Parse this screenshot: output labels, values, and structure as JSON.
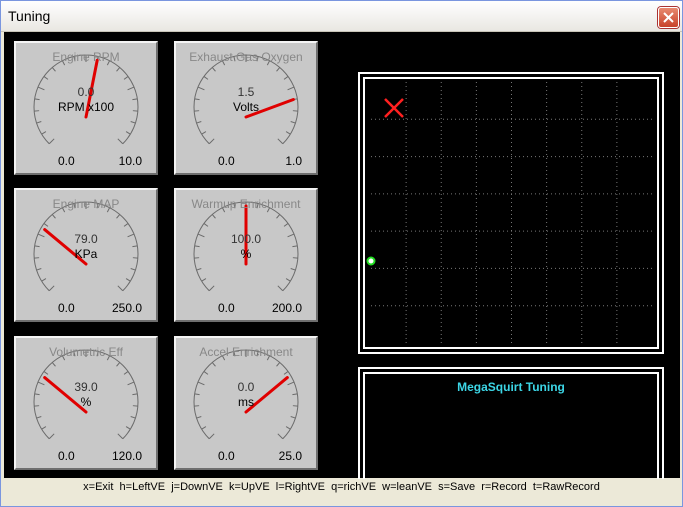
{
  "window": {
    "title": "Tuning"
  },
  "gauges": [
    {
      "title": "Engine RPM",
      "value": "0.0",
      "unit": "RPM x100",
      "min_label": "0.0",
      "max_label": "10.0",
      "fraction": 0.55
    },
    {
      "title": "Exhaust Gas Oxygen",
      "value": "1.5",
      "unit": "Volts",
      "min_label": "0.0",
      "max_label": "1.0",
      "fraction": 0.8
    },
    {
      "title": "Engine MAP",
      "value": "79.0",
      "unit": "KPa",
      "min_label": "0.0",
      "max_label": "250.0",
      "fraction": 0.28
    },
    {
      "title": "Warmup Enrichment",
      "value": "100.0",
      "unit": "%",
      "min_label": "0.0",
      "max_label": "200.0",
      "fraction": 0.5
    },
    {
      "title": "Volumetric Eff",
      "value": "39.0",
      "unit": "%",
      "min_label": "0.0",
      "max_label": "120.0",
      "fraction": 0.28
    },
    {
      "title": "Accel Enrichment",
      "value": "0.0",
      "unit": "ms",
      "min_label": "0.0",
      "max_label": "25.0",
      "fraction": 0.72
    }
  ],
  "panel": {
    "title": "MegaSquirt Tuning"
  },
  "statusbar": {
    "text": "x=Exit  h=LeftVE  j=DownVE  k=UpVE  l=RightVE  q=richVE  w=leanVE  s=Save  r=Record  t=RawRecord"
  },
  "colors": {
    "needle": "#e00000",
    "panel_title": "#3cd6e6",
    "marker": "#ff2020",
    "dot": "#22dd22"
  }
}
